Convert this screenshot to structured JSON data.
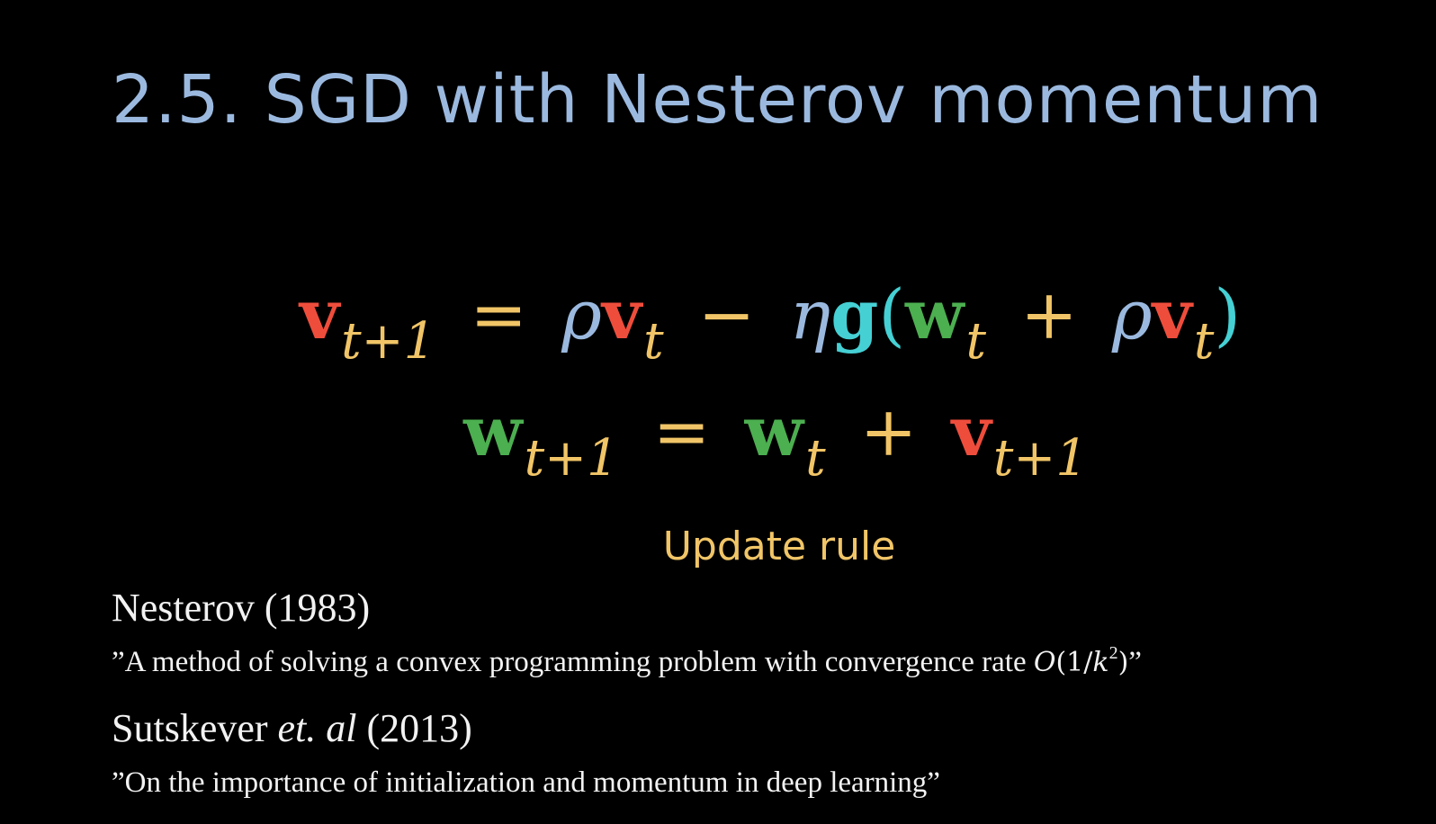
{
  "slide": {
    "title": "2.5. SGD with Nesterov momentum",
    "caption": "Update rule"
  },
  "equations": {
    "eq1": {
      "lhs_var": "v",
      "lhs_sub": "t+1",
      "eq_sign": "=",
      "rho1": "ρ",
      "v2": "v",
      "v2_sub": "t",
      "minus": "−",
      "eta": "η",
      "g": "g",
      "open_paren": "(",
      "w": "w",
      "w_sub": "t",
      "plus": "+",
      "rho2": "ρ",
      "v3": "v",
      "v3_sub": "t",
      "close_paren": ")"
    },
    "eq2": {
      "lhs_var": "w",
      "lhs_sub": "t+1",
      "eq_sign": "=",
      "w": "w",
      "w_sub": "t",
      "plus": "+",
      "v": "v",
      "v_sub": "t+1"
    }
  },
  "references": [
    {
      "author": "Nesterov",
      "year": "(1983)",
      "quote_start": "”A method of solving a convex programming problem with convergence rate ",
      "quote_math_O": "O",
      "quote_math_open": "(1/",
      "quote_math_k": "k",
      "quote_math_exp": "2",
      "quote_math_close": ")",
      "quote_end": "”"
    },
    {
      "author": "Sutskever",
      "etal": "et. al",
      "year": "(2013)",
      "quote": "”On the importance of initialization and momentum in deep learning”"
    }
  ],
  "colors": {
    "background": "#000000",
    "title": "#9bb9df",
    "velocity": "#ef4d3c",
    "subscript": "#f1c567",
    "operator": "#f1c567",
    "rho": "#9bb9df",
    "eta": "#9bb9df",
    "gradient": "#45d0d4",
    "paren": "#45d0d4",
    "weight": "#4caf50",
    "caption": "#f1c567",
    "reference_text": "#f2f2f2"
  }
}
